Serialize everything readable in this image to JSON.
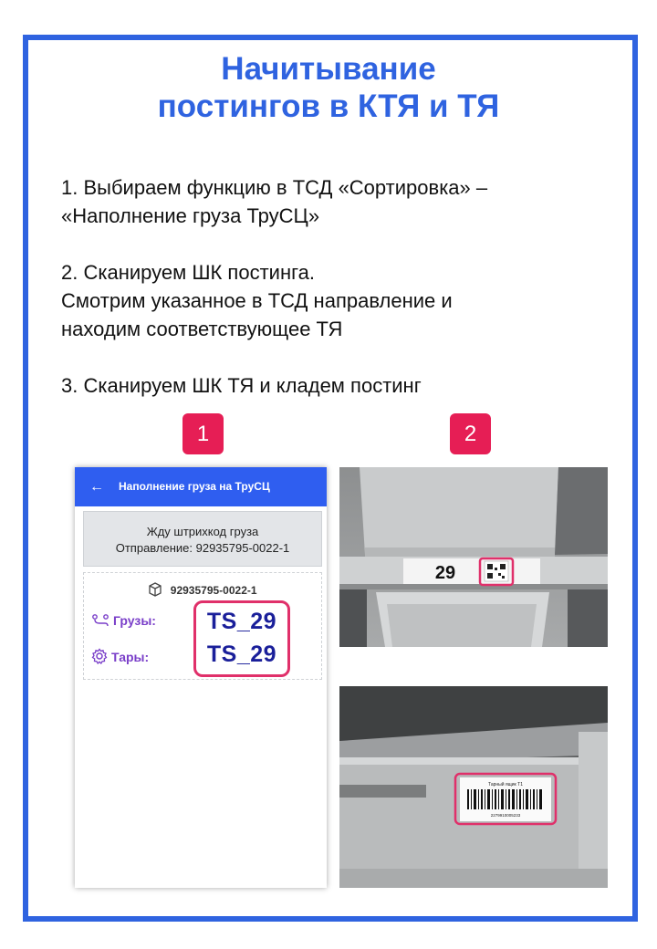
{
  "title": {
    "line1": "Начитывание",
    "line2": "постингов в КТЯ и ТЯ"
  },
  "steps": {
    "s1_line1": "1. Выбираем функцию в ТСД «Сортировка» –",
    "s1_line2": "«Наполнение груза ТруСЦ»",
    "s2_line1": "2. Сканируем ШК постинга.",
    "s2_line2": "Смотрим указанное в ТСД направление и",
    "s2_line3": "находим соответствующее ТЯ",
    "s3_line1": "3. Сканируем ШК ТЯ и кладем постинг"
  },
  "badges": {
    "b1": "1",
    "b2": "2"
  },
  "phone": {
    "back_icon": "arrow-left-icon",
    "header_title": "Наполнение груза на ТруСЦ",
    "wait_line1": "Жду штрихкод груза",
    "wait_line2": "Отправление: 92935795-0022-1",
    "package_icon": "box-icon",
    "posting_number": "92935795-0022-1",
    "cargo_label": "Грузы:",
    "cargo_value": "TS_29",
    "tare_label": "Тары:",
    "tare_value": "TS_29",
    "accent_color": "#2f5ef0",
    "highlight_color": "#e0306a"
  },
  "photo1": {
    "shelf_number": "29"
  },
  "photo2": {
    "label_title": "Тарный ящик T1",
    "label_code": "2279910005233"
  },
  "colors": {
    "frame": "#2f63e0",
    "badge": "#e61e55"
  }
}
